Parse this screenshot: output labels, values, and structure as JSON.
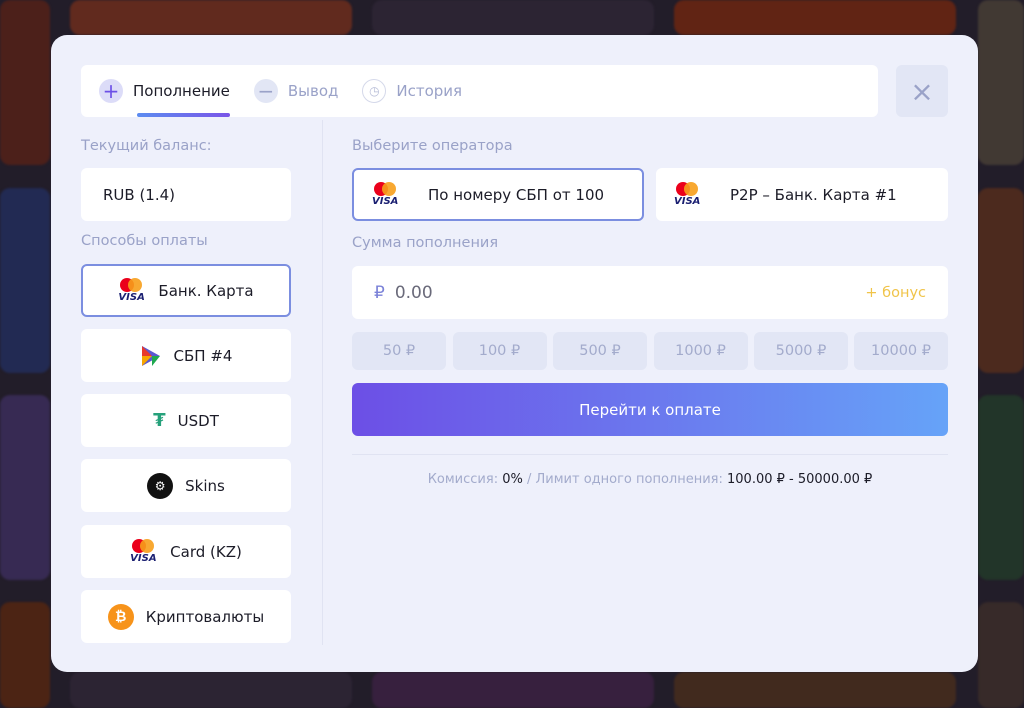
{
  "tabs": [
    {
      "label": "Пополнение",
      "icon": "plus-icon"
    },
    {
      "label": "Вывод",
      "icon": "minus-icon"
    },
    {
      "label": "История",
      "icon": "clock-icon"
    }
  ],
  "close_icon": "×",
  "balance": {
    "label": "Текущий баланс:",
    "value": "RUB (1.4)"
  },
  "methods": {
    "label": "Способы оплаты",
    "items": [
      {
        "label": "Банк. Карта",
        "icon": "mastercard-visa-icon"
      },
      {
        "label": "СБП #4",
        "icon": "sbp-icon"
      },
      {
        "label": "USDT",
        "icon": "tether-icon"
      },
      {
        "label": "Skins",
        "icon": "steam-icon"
      },
      {
        "label": "Card (KZ)",
        "icon": "mastercard-visa-icon"
      },
      {
        "label": "Криптовалюты",
        "icon": "bitcoin-icon"
      }
    ]
  },
  "operator": {
    "label": "Выберите оператора",
    "items": [
      {
        "label": "По номеру СБП от 100"
      },
      {
        "label": "P2P – Банк. Карта #1"
      }
    ]
  },
  "amount": {
    "label": "Сумма пополнения",
    "currency": "₽",
    "placeholder": "0.00",
    "bonus": "+ бонус"
  },
  "quick_amounts": [
    "50 ₽",
    "100 ₽",
    "500 ₽",
    "1000 ₽",
    "5000 ₽",
    "10000 ₽"
  ],
  "pay_button": "Перейти к оплате",
  "info": {
    "commission_label": "Комиссия:",
    "commission": "0%",
    "sep": "/",
    "limit_label": "Лимит одного пополнения:",
    "limit": "100.00 ₽ - 50000.00 ₽"
  },
  "colors": {
    "accent": "#6c4fe6",
    "bonus": "#f0c44a"
  }
}
